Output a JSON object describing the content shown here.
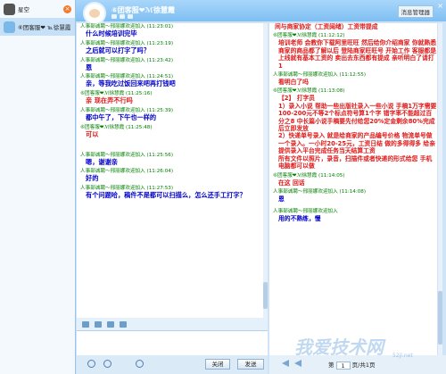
{
  "sidebar": {
    "contacts": [
      {
        "name": "星空",
        "unread_close": "×"
      },
      {
        "name": "⑥团客服❤ ℡徐慧霞"
      }
    ]
  },
  "titlebar": {
    "title": "⑥团客服❤ℳ徐慧霞"
  },
  "right_header": {
    "message_manager": "消息管理器",
    "close": "×"
  },
  "chat": {
    "messages": [
      {
        "sender": "人事部诚聘～邢丽娜欢迎加入",
        "time": "(11:23:01)",
        "text": "什么时候培训完毕",
        "color": "blue"
      },
      {
        "sender": "人事部诚聘～邢丽娜欢迎加入",
        "time": "(11:23:19)",
        "text": "之后就可以打字了吗？",
        "color": "blue"
      },
      {
        "sender": "人事部诚聘～邢丽娜欢迎加入",
        "time": "(11:23:42)",
        "text": "恩",
        "color": "blue"
      },
      {
        "sender": "人事部诚聘～邢丽娜欢迎加入",
        "time": "(11:24:51)",
        "text": "亲，等我吃过饭回来吧再打钱吧",
        "color": "blue"
      },
      {
        "sender": "⑥团客服❤ℳ徐慧霞",
        "time": "(11:25:16)",
        "text": "亲 现在弄不行吗",
        "color": "red"
      },
      {
        "sender": "人事部诚聘～邢丽娜欢迎加入",
        "time": "(11:25:39)",
        "text": "都中午了，下午也一样的",
        "color": "blue"
      },
      {
        "sender": "⑥团客服❤ℳ徐慧霞",
        "time": "(11:25:48)",
        "text": "可以",
        "color": "red"
      },
      {
        "sender": "人事部诚聘～邢丽娜欢迎加入",
        "time": "(11:25:56)",
        "text": "嗯，谢谢亲",
        "color": "blue"
      },
      {
        "sender": "人事部诚聘～邢丽娜欢迎加入",
        "time": "(11:26:04)",
        "text": "好的",
        "color": "blue"
      },
      {
        "sender": "人事部诚聘～邢丽娜欢迎加入",
        "time": "(11:27:53)",
        "text": "有个问题哈，稿件不是都可以扫描么，怎么还手工打字？",
        "color": "blue"
      }
    ]
  },
  "input_bar": {
    "close_label": "关闭",
    "send_label": "发送"
  },
  "history": {
    "messages": [
      {
        "sender": "",
        "time": "",
        "text": "间与商家协定（工资阔绪）工资带提成",
        "color": "red"
      },
      {
        "sender": "⑥团客服❤ℳ徐慧霞",
        "time": "(11:12:12)",
        "text": "培训老师 会教你下载阿里旺旺 然后给你介绍商家 你就熟悉 商家的商品都了解以后 登陆商家旺旺号 开始工作 客服都是上线就有基本工资的 卖出去东西都有提成 亲听明白了请打1",
        "color": "red"
      },
      {
        "sender": "人事部诚聘～邢丽娜欢迎加入",
        "time": "(11:12:55)",
        "text": "看明白了吗",
        "color": "red"
      },
      {
        "sender": "⑥团客服❤ℳ徐慧霞",
        "time": "(11:13:08)",
        "text": "【2】 打字员\n1）录入小说 帮助一些出版社录入一些小说 手稿1万字需要100-200元不等2个标点符号算1个字 错字率不能超过百分之8 中长篇小说手稿要先付给您20%定金剩余80%完成后立即发放\n2）快递单号录入 就是给商家的产品编号价格 物流单号做一个录入。一小时20-25元，工资日结 做的多得得多 给亲提供录入平台完成任务当天结算工资\n所有文件以照片，录音，扫描件或者快递的形式给您 手机电脑都可以做",
        "color": "red"
      },
      {
        "sender": "⑥团客服❤ℳ徐慧霞",
        "time": "(11:14:05)",
        "text": "在这 回话",
        "color": "red"
      },
      {
        "sender": "人事部诚聘～邢丽娜欢迎加入",
        "time": "(11:14:08)",
        "text": "恩",
        "color": "blue"
      },
      {
        "sender": "人事部诚聘～邢丽娜欢迎加入",
        "time": "",
        "text": "用的不熟练，慢",
        "color": "blue"
      }
    ]
  },
  "pager": {
    "page": "1",
    "total": "页/共1页"
  },
  "watermark": {
    "text": "我爱技术网",
    "url": "52jl.net"
  }
}
